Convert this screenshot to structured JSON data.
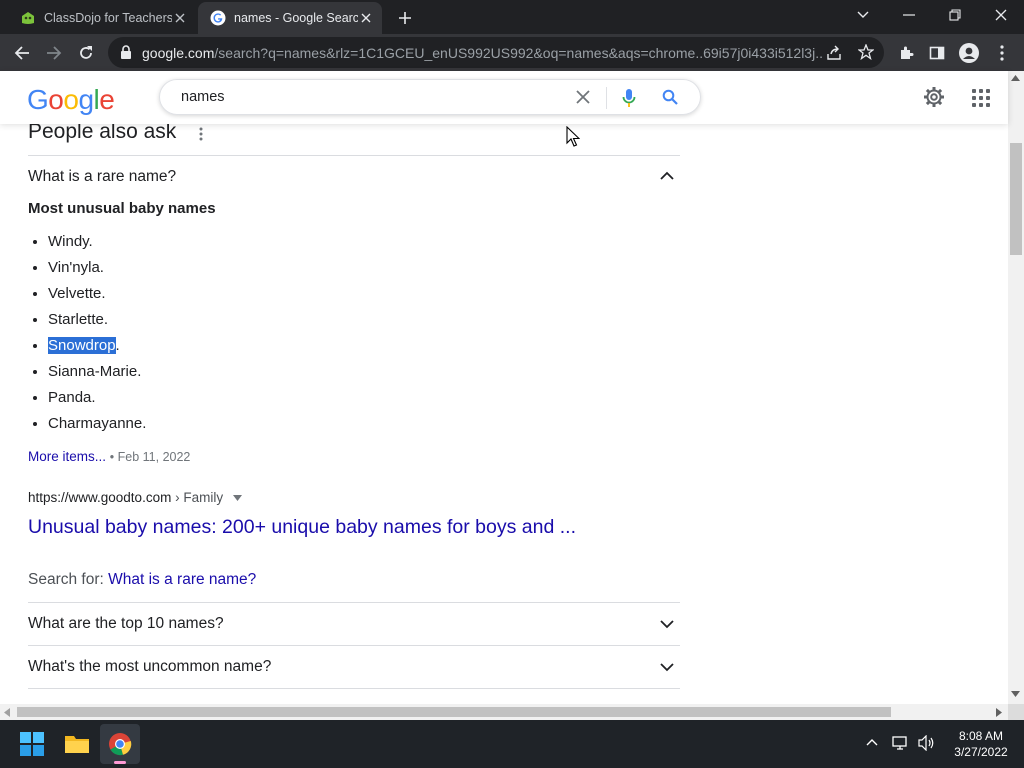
{
  "browser": {
    "tabs": [
      {
        "title": "ClassDojo for Teachers",
        "active": false
      },
      {
        "title": "names - Google Search",
        "active": true
      }
    ],
    "url_host": "google.com",
    "url_rest": "/search?q=names&rlz=1C1GCEU_enUS992US992&oq=names&aqs=chrome..69i57j0i433i512l3j..."
  },
  "google": {
    "logo_letters": [
      "G",
      "o",
      "o",
      "g",
      "l",
      "e"
    ],
    "logo_colors": [
      "#4285F4",
      "#EA4335",
      "#FBBC05",
      "#4285F4",
      "#34A853",
      "#EA4335"
    ],
    "search_value": "names"
  },
  "people_also_ask": {
    "heading": "People also ask",
    "expanded_question": "What is a rare name?",
    "answer_title": "Most unusual baby names",
    "answer_items": [
      "Windy.",
      "Vin'nyla.",
      "Velvette.",
      "Starlette.",
      "Snowdrop",
      "Sianna-Marie.",
      "Panda.",
      "Charmayanne."
    ],
    "highlighted_item": "Snowdrop",
    "highlighted_suffix": ".",
    "more_items": "More items...",
    "date": "Feb 11, 2022",
    "source_url": "https://www.goodto.com",
    "source_crumb": "› Family",
    "result_title": "Unusual baby names: 200+ unique baby names for boys and ...",
    "search_for_label": "Search for:",
    "search_for_link": "What is a rare name?",
    "collapsed_questions": [
      "What are the top 10 names?",
      "What's the most uncommon name?"
    ]
  },
  "taskbar": {
    "time": "8:08 AM",
    "date": "3/27/2022"
  }
}
